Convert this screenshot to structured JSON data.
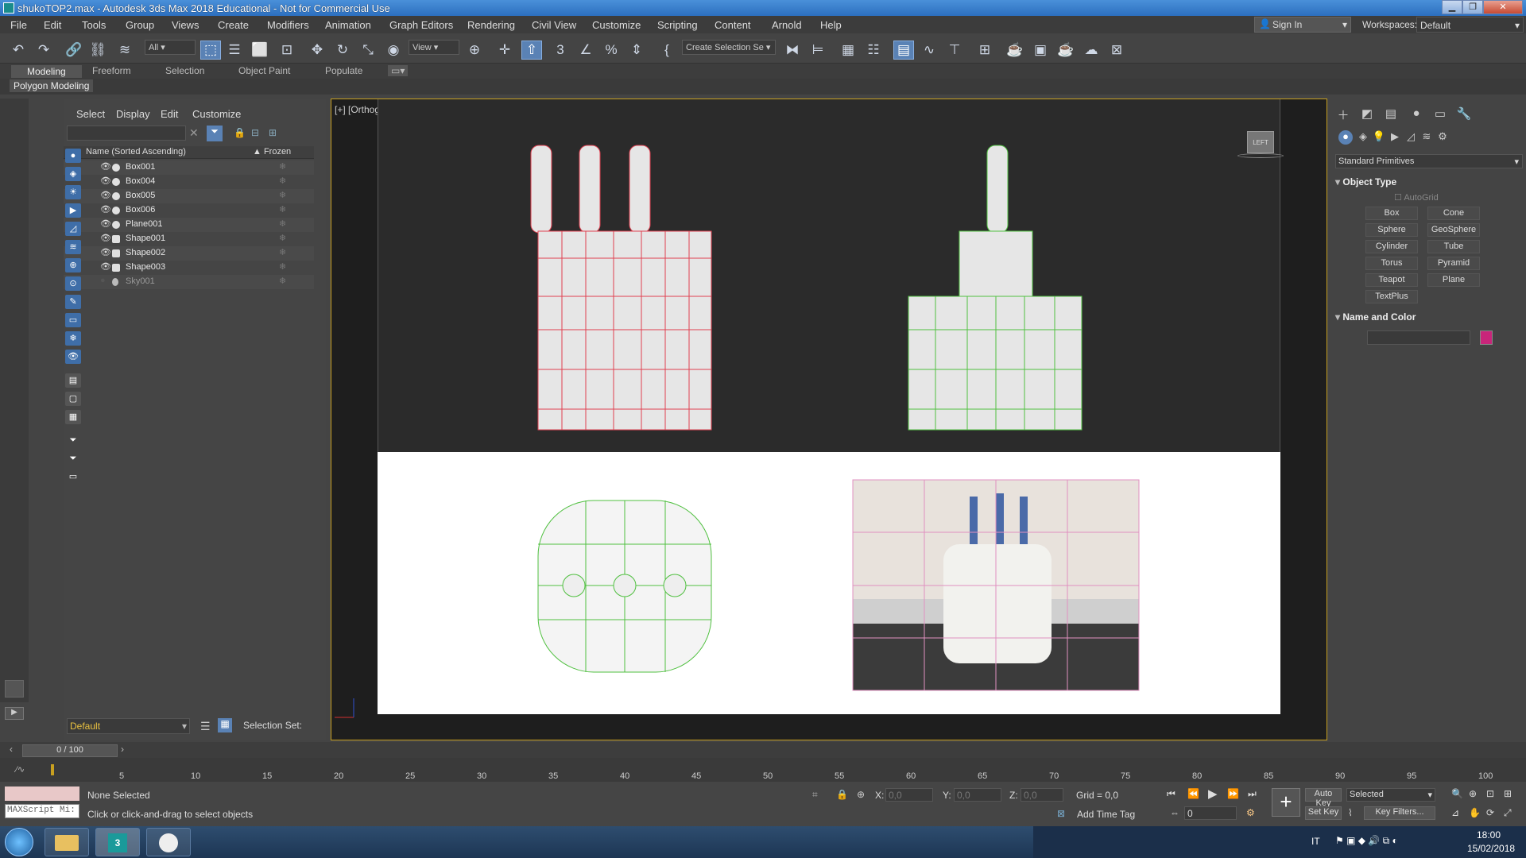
{
  "window": {
    "title": "shukoTOP2.max - Autodesk 3ds Max 2018 Educational - Not for Commercial Use"
  },
  "menu": [
    "File",
    "Edit",
    "Tools",
    "Group",
    "Views",
    "Create",
    "Modifiers",
    "Animation",
    "Graph Editors",
    "Rendering",
    "Civil View",
    "Customize",
    "Scripting",
    "Content",
    "Arnold",
    "Help"
  ],
  "account": {
    "signin": "Sign In",
    "workspaces_label": "Workspaces:",
    "workspace": "Default"
  },
  "toolbar": {
    "filter": "All",
    "refcoord": "View",
    "selset": "Create Selection Se"
  },
  "ribbon": {
    "tabs": [
      "Modeling",
      "Freeform",
      "Selection",
      "Object Paint",
      "Populate"
    ],
    "panel": "Polygon Modeling"
  },
  "scene": {
    "tabs": [
      "Select",
      "Display",
      "Edit",
      "Customize"
    ],
    "col_name": "Name (Sorted Ascending)",
    "col_frozen": "▲ Frozen",
    "rows": [
      "Box001",
      "Box004",
      "Box005",
      "Box006",
      "Plane001",
      "Shape001",
      "Shape002",
      "Shape003",
      "Sky001"
    ],
    "layer": "Default",
    "selection_set": "Selection Set:"
  },
  "viewport": {
    "label": "[+] [Orthographic ] [Standard ] [Edged Faces ]",
    "viewcube": "LEFT"
  },
  "command": {
    "category": "Standard Primitives",
    "rollout_object": "Object Type",
    "autogrid": "AutoGrid",
    "buttons": [
      "Box",
      "Cone",
      "Sphere",
      "GeoSphere",
      "Cylinder",
      "Tube",
      "Torus",
      "Pyramid",
      "Teapot",
      "Plane",
      "TextPlus"
    ],
    "rollout_name": "Name and Color",
    "color": "#c8257a"
  },
  "timeline": {
    "frame": "0 / 100",
    "ticks": [
      "5",
      "10",
      "15",
      "20",
      "25",
      "30",
      "35",
      "40",
      "45",
      "50",
      "55",
      "60",
      "65",
      "70",
      "75",
      "80",
      "85",
      "90",
      "95",
      "100"
    ]
  },
  "status": {
    "selection": "None Selected",
    "prompt": "Click or click-and-drag to select objects",
    "maxscript": "MAXScript Mi:",
    "x_label": "X:",
    "y_label": "Y:",
    "z_label": "Z:",
    "x": "0,0",
    "y": "0,0",
    "z": "0,0",
    "grid": "Grid = 0,0",
    "add_time_tag": "Add Time Tag",
    "auto_key": "Auto Key",
    "set_key": "Set Key",
    "key_mode": "Selected",
    "key_filters": "Key Filters...",
    "frame_field": "0"
  },
  "taskbar": {
    "lang": "IT",
    "time": "18:00",
    "date": "15/02/2018"
  }
}
